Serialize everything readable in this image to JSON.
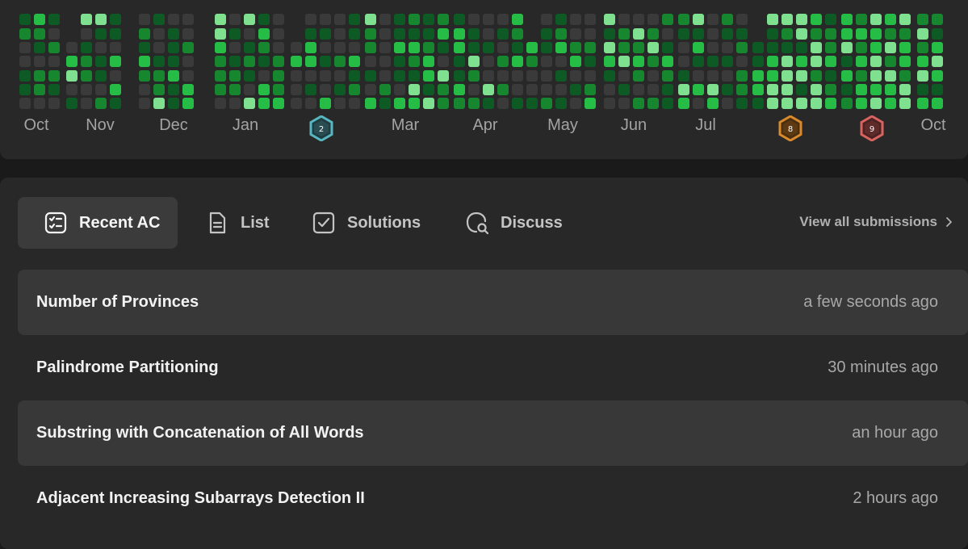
{
  "heatmap": {
    "colors": {
      "empty": "#3a3a3a",
      "level1": "#0e5a24",
      "level2": "#16872f",
      "level3": "#26bd46",
      "level4": "#7fe08f"
    },
    "months": [
      "Oct",
      "Nov",
      "Dec",
      "Jan",
      "Mar",
      "Apr",
      "May",
      "Jun",
      "Jul",
      "Oct"
    ],
    "badges": [
      {
        "icon": "hexagon-badge-teal-icon",
        "label": "2",
        "color": "#57b6bf"
      },
      {
        "icon": "hexagon-badge-orange-icon",
        "label": "8",
        "color": "#d98a2b"
      },
      {
        "icon": "hexagon-badge-red-icon",
        "label": "9",
        "color": "#d9635f"
      }
    ]
  },
  "tabs": [
    {
      "label": "Recent AC",
      "icon": "recent-ac-icon"
    },
    {
      "label": "List",
      "icon": "list-document-icon"
    },
    {
      "label": "Solutions",
      "icon": "solutions-checkbox-icon"
    },
    {
      "label": "Discuss",
      "icon": "discuss-search-icon"
    }
  ],
  "view_all": {
    "label": "View all submissions",
    "icon": "chevron-right-icon"
  },
  "submissions": [
    {
      "title": "Number of Provinces",
      "time": "a few seconds ago"
    },
    {
      "title": "Palindrome Partitioning",
      "time": "30 minutes ago"
    },
    {
      "title": "Substring with Concatenation of All Words",
      "time": "an hour ago"
    },
    {
      "title": "Adjacent Increasing Subarrays Detection II",
      "time": "2 hours ago"
    }
  ]
}
